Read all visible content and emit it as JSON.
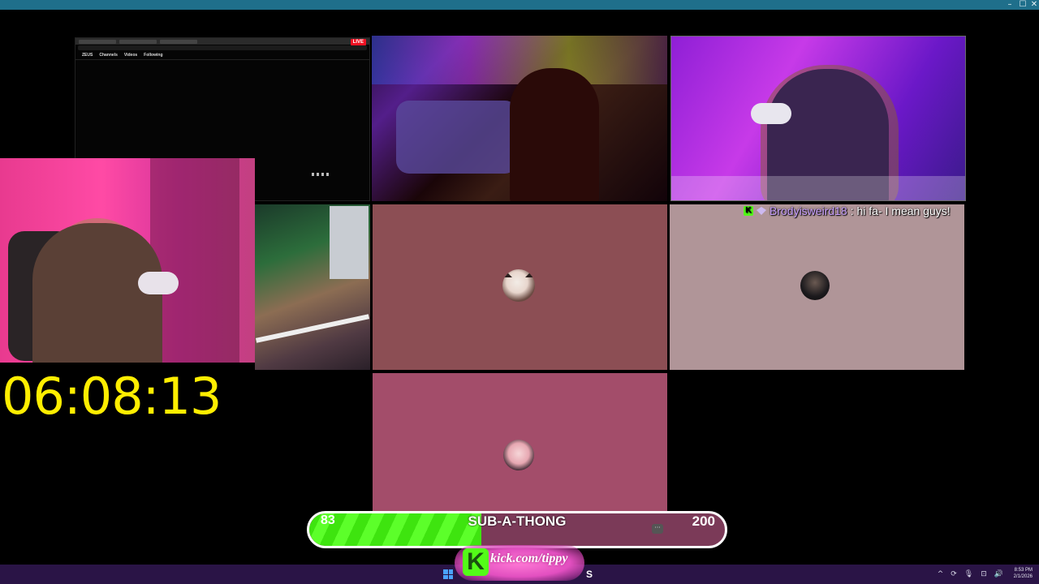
{
  "window": {
    "controls": [
      "–",
      "☐",
      "✕"
    ]
  },
  "browser": {
    "live_label": "LIVE",
    "nav_items": [
      "ZEUS",
      "Channels",
      "Videos",
      "Following"
    ]
  },
  "chat": {
    "username": "Brodyisweird18",
    "message": ": hi fa- I mean guys!"
  },
  "timer": {
    "value": "06:08:13"
  },
  "subathon": {
    "current": "83",
    "title": "SUB-A-THONG",
    "goal": "200",
    "menu_label": "···",
    "progress": 0.415
  },
  "kick": {
    "k_letter": "K",
    "url": "kick.com/tippy"
  },
  "taskbar": {
    "app_label": "S",
    "tray_icons": [
      "^",
      "⟳",
      "🎙",
      "⊡",
      "🔊"
    ],
    "time": "8:53 PM",
    "date": "2/1/2026"
  },
  "colors": {
    "timer": "#ffee00",
    "progress_fill": "#3ee40f",
    "kick_green": "#53fc18",
    "chat_username": "#c9a0ff"
  }
}
